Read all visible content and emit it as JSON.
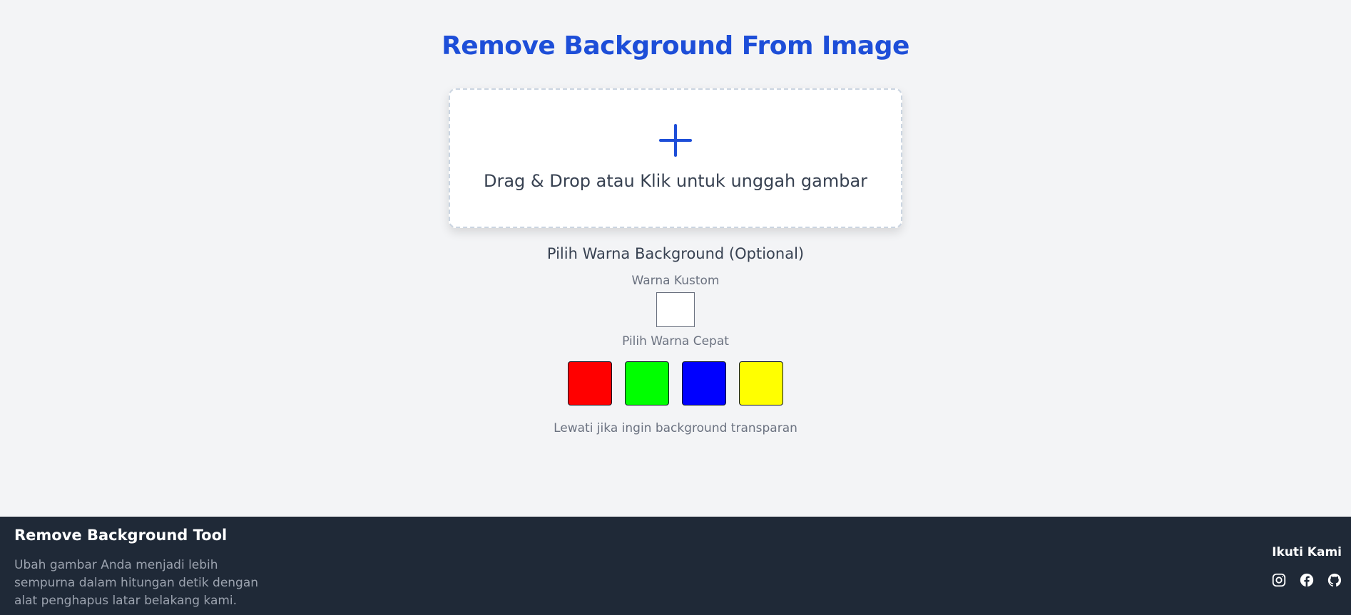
{
  "header": {
    "title": "Remove Background From Image"
  },
  "upload": {
    "icon": "plus-icon",
    "text": "Drag & Drop atau Klik untuk unggah gambar"
  },
  "background_color": {
    "title": "Pilih Warna Background (Optional)",
    "custom_label": "Warna Kustom",
    "custom_value": "#ffffff",
    "quick_label": "Pilih Warna Cepat",
    "quick_colors": [
      "#ff0000",
      "#00ff00",
      "#0000ff",
      "#ffff00"
    ],
    "hint": "Lewati jika ingin background transparan"
  },
  "footer": {
    "title": "Remove Background Tool",
    "description": "Ubah gambar Anda menjadi lebih sempurna dalam hitungan detik dengan alat penghapus latar belakang kami.",
    "follow_title": "Ikuti Kami",
    "social_icons": [
      "instagram-icon",
      "facebook-icon",
      "github-icon"
    ]
  },
  "colors": {
    "accent": "#1d4ed8",
    "page_bg": "#f3f4f6",
    "footer_bg": "#1f2937"
  }
}
